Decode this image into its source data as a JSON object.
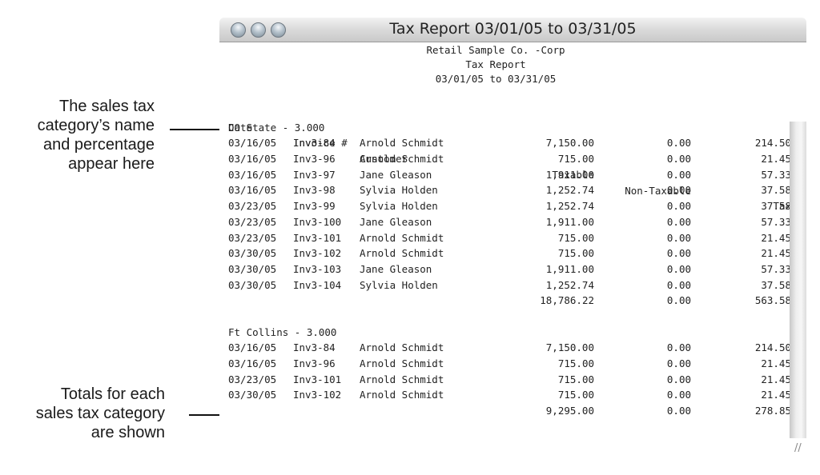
{
  "annotations": {
    "category_callout": [
      "The sales tax",
      "category’s name",
      "and percentage",
      "appear here"
    ],
    "totals_callout": [
      "Totals for each",
      "sales tax category",
      "are shown"
    ]
  },
  "window": {
    "title": "Tax Report 03/01/05 to 03/31/05",
    "controls": [
      "close-button",
      "minimize-button",
      "zoom-button"
    ]
  },
  "report": {
    "company": "Retail Sample Co. -Corp",
    "name": "Tax Report",
    "period": "03/01/05 to 03/31/05",
    "columns": [
      "Date",
      "Invoice #",
      "Customer",
      "Taxable",
      "Non-Taxable",
      "Tax"
    ],
    "categories": [
      {
        "label": "CO State - 3.000",
        "rows": [
          {
            "date": "03/16/05",
            "invoice": "Inv3-84",
            "customer": "Arnold Schmidt",
            "taxable": "7,150.00",
            "non_taxable": "0.00",
            "tax": "214.50"
          },
          {
            "date": "03/16/05",
            "invoice": "Inv3-96",
            "customer": "Arnold Schmidt",
            "taxable": "715.00",
            "non_taxable": "0.00",
            "tax": "21.45"
          },
          {
            "date": "03/16/05",
            "invoice": "Inv3-97",
            "customer": "Jane Gleason",
            "taxable": "1,911.00",
            "non_taxable": "0.00",
            "tax": "57.33"
          },
          {
            "date": "03/16/05",
            "invoice": "Inv3-98",
            "customer": "Sylvia Holden",
            "taxable": "1,252.74",
            "non_taxable": "0.00",
            "tax": "37.58"
          },
          {
            "date": "03/23/05",
            "invoice": "Inv3-99",
            "customer": "Sylvia Holden",
            "taxable": "1,252.74",
            "non_taxable": "0.00",
            "tax": "37.58"
          },
          {
            "date": "03/23/05",
            "invoice": "Inv3-100",
            "customer": "Jane Gleason",
            "taxable": "1,911.00",
            "non_taxable": "0.00",
            "tax": "57.33"
          },
          {
            "date": "03/23/05",
            "invoice": "Inv3-101",
            "customer": "Arnold Schmidt",
            "taxable": "715.00",
            "non_taxable": "0.00",
            "tax": "21.45"
          },
          {
            "date": "03/30/05",
            "invoice": "Inv3-102",
            "customer": "Arnold Schmidt",
            "taxable": "715.00",
            "non_taxable": "0.00",
            "tax": "21.45"
          },
          {
            "date": "03/30/05",
            "invoice": "Inv3-103",
            "customer": "Jane Gleason",
            "taxable": "1,911.00",
            "non_taxable": "0.00",
            "tax": "57.33"
          },
          {
            "date": "03/30/05",
            "invoice": "Inv3-104",
            "customer": "Sylvia Holden",
            "taxable": "1,252.74",
            "non_taxable": "0.00",
            "tax": "37.58"
          }
        ],
        "total": {
          "taxable": "18,786.22",
          "non_taxable": "0.00",
          "tax": "563.58"
        }
      },
      {
        "label": "Ft Collins - 3.000",
        "rows": [
          {
            "date": "03/16/05",
            "invoice": "Inv3-84",
            "customer": "Arnold Schmidt",
            "taxable": "7,150.00",
            "non_taxable": "0.00",
            "tax": "214.50"
          },
          {
            "date": "03/16/05",
            "invoice": "Inv3-96",
            "customer": "Arnold Schmidt",
            "taxable": "715.00",
            "non_taxable": "0.00",
            "tax": "21.45"
          },
          {
            "date": "03/23/05",
            "invoice": "Inv3-101",
            "customer": "Arnold Schmidt",
            "taxable": "715.00",
            "non_taxable": "0.00",
            "tax": "21.45"
          },
          {
            "date": "03/30/05",
            "invoice": "Inv3-102",
            "customer": "Arnold Schmidt",
            "taxable": "715.00",
            "non_taxable": "0.00",
            "tax": "21.45"
          }
        ],
        "total": {
          "taxable": "9,295.00",
          "non_taxable": "0.00",
          "tax": "278.85"
        }
      }
    ]
  },
  "icons": {
    "resize_grip": "//"
  }
}
